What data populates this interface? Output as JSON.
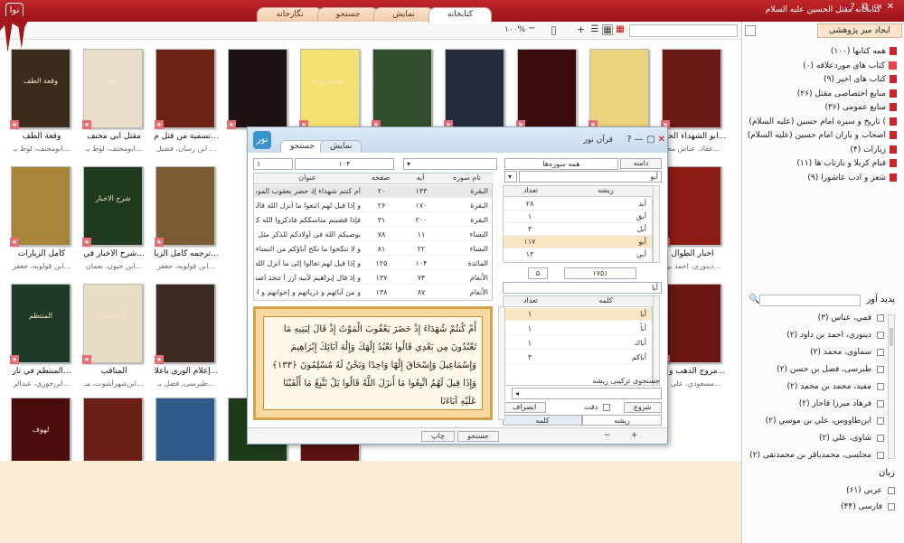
{
  "window": {
    "title": "کتابخانه مقتل الحسین علیه السلام",
    "logo_text": "نوا",
    "controls": [
      "?",
      "⧉",
      "▭",
      "✕"
    ]
  },
  "tabs": [
    "کتابخانه",
    "نمایش",
    "جستجو",
    "نگارخانه"
  ],
  "toolbar": {
    "zoom": "۱۰۰%",
    "minus": "−",
    "plus": "+"
  },
  "books": [
    {
      "title": "وقعة الطف",
      "author": "ابومخنف، لوط بـ...",
      "cover_color": "#3b2b1d",
      "cover_text": "وقعة الطف"
    },
    {
      "title": "مقتل أبي مخنف",
      "author": "ابومخنف، لوط بـ...",
      "cover_color": "#e9dcc9",
      "cover_text": "مقتل"
    },
    {
      "title": "تسمية من قتل م...",
      "author": "ابن رسان، فضيل ...",
      "cover_color": "#6d2316",
      "cover_text": ""
    },
    {
      "title": "",
      "author": "",
      "cover_color": "#1b1312",
      "cover_text": ""
    },
    {
      "title": "",
      "author": "",
      "cover_color": "#f3e070",
      "cover_text": "شهدای کربلا"
    },
    {
      "title": "",
      "author": "",
      "cover_color": "#2f4e2c",
      "cover_text": ""
    },
    {
      "title": "",
      "author": "",
      "cover_color": "#232a3c",
      "cover_text": ""
    },
    {
      "title": "",
      "author": "",
      "cover_color": "#3a0b0b",
      "cover_text": ""
    },
    {
      "title": "",
      "author": "",
      "cover_color": "#e9d37c",
      "cover_text": ""
    },
    {
      "title": "ابو الشهداء الحسـ...",
      "author": "عقاد، عباس محـ...",
      "cover_color": "#6a1a14",
      "cover_text": ""
    },
    {
      "title": "كامل الزيارات",
      "author": "ابن قولويه، جعفر...",
      "cover_color": "#a8843a",
      "cover_text": ""
    },
    {
      "title": "شرح الأخبار في...",
      "author": "ابن حيون، نعمان...",
      "cover_color": "#1f3a1e",
      "cover_text": "شرح الاخبار"
    },
    {
      "title": "ترجمه كامل الزيا...",
      "author": "ابن قولويه، جعفر...",
      "cover_color": "#7c5a34",
      "cover_text": ""
    },
    {
      "title": "أخبار الطوال",
      "author": "دينوري، احمد بن...",
      "cover_color": "#8b1b15",
      "cover_text": ""
    },
    {
      "title": "المنتظم في تار...",
      "author": "ابن‌جوزی، عبدالر...",
      "cover_color": "#1e3a29",
      "cover_text": "المنتظم"
    },
    {
      "title": "المناقب",
      "author": "ابن‌شهرآشوب، مـ...",
      "cover_color": "#e9dcc4",
      "cover_text": "المناقب"
    },
    {
      "title": "إعلام الورى بأعلا...",
      "author": "طبرسی، فضل بـ...",
      "cover_color": "#3d2b22",
      "cover_text": ""
    },
    {
      "title": "مروج الذهب و مـ...",
      "author": "مسعودي، علي بـ...",
      "cover_color": "#6a1612",
      "cover_text": ""
    },
    {
      "title": "",
      "author": "",
      "cover_color": "#4a0c0c",
      "cover_text": "لهوف"
    },
    {
      "title": "",
      "author": "",
      "cover_color": "#6b1e16",
      "cover_text": ""
    },
    {
      "title": "",
      "author": "",
      "cover_color": "#2f5a8a",
      "cover_text": ""
    },
    {
      "title": "",
      "author": "",
      "cover_color": "#1d3b1b",
      "cover_text": ""
    },
    {
      "title": "",
      "author": "",
      "cover_color": "#5a1212",
      "cover_text": ""
    }
  ],
  "sidebar": {
    "new_desk": "ایجاد میز پژوهشی",
    "categories": [
      {
        "label": "همه کتابها (۱۰۰)",
        "icon": "book-icon"
      },
      {
        "label": "کتاب های موردعلاقه (۰)",
        "icon": "star-icon"
      },
      {
        "label": "کتاب های اخیر (۹)",
        "icon": "book-icon"
      },
      {
        "label": "منابع اختصاصی مقتل (۲۶)",
        "icon": "book-icon"
      },
      {
        "label": "منابع عمومی (۳۶)",
        "icon": "book-icon"
      },
      {
        "label": "تاریخ و سیره امام حسین (علیه السلام) (",
        "icon": "book-icon"
      },
      {
        "label": "اصحاب و یاران امام حسین (علیه السلام)",
        "icon": "book-icon"
      },
      {
        "label": "زیارات (۴)",
        "icon": "book-icon"
      },
      {
        "label": "قیام کربلا و بازتاب ها (۱۱)",
        "icon": "book-icon"
      },
      {
        "label": "شعر و ادب عاشورا (۹)",
        "icon": "book-icon"
      }
    ],
    "authors_header": "پدید آور",
    "authors": [
      "قمي، عباس (۳)",
      "دينوري، احمد بن داود (۲)",
      "سماوی، محمد (۲)",
      "طبرسی، فضل بن حسن (۲)",
      "مفید، محمد بن محمد (۲)",
      "فرهاد میرزا قاجار (۲)",
      "ابن‌طاووس، علي بن موسي (۲)",
      "شاوی، علي (۲)",
      "مجلسی، محمدباقر بن محمدتقی (۲)"
    ],
    "language_header": "زبان",
    "languages": [
      "عربي (۶۱)",
      "فارسی (۴۴)"
    ]
  },
  "dialog": {
    "title": "قرآن نور",
    "icon_text": "نور",
    "tabs": [
      "جستجو",
      "نمایش"
    ],
    "range_left": "۱",
    "range_right": "۱۰۴",
    "scope_btn": "دامنه",
    "surah_select": "همه سوره‌ها",
    "root_input": "أبو",
    "results_columns": [
      "نام سوره",
      "آیه",
      "صفحه",
      "عنوان"
    ],
    "results": [
      {
        "surah": "البقرة",
        "ayah": "۱۳۳",
        "page": "۲۰",
        "text": "أم كنتم شهداء إذ حضر يعقوب الموت إذ ق..."
      },
      {
        "surah": "البقرة",
        "ayah": "۱۷۰",
        "page": "۲۶",
        "text": "و إذا قيل لهم اتبعوا ما أنزل الله قالوا بل نتبـ..."
      },
      {
        "surah": "البقرة",
        "ayah": "۲۰۰",
        "page": "۳۱",
        "text": "فإذا قضيتم مناسككم فاذكروا الله كذكركم آ..."
      },
      {
        "surah": "النساء",
        "ayah": "۱۱",
        "page": "۷۸",
        "text": "يوصيكم الله في أولادكم للذكر مثل حظ الأ..."
      },
      {
        "surah": "النساء",
        "ayah": "۲۲",
        "page": "۸۱",
        "text": "و لا تنكحوا ما نكح آباؤكم من النساء إلا ما ..."
      },
      {
        "surah": "المائدة",
        "ayah": "۱۰۴",
        "page": "۱۲۵",
        "text": "و إذا قيل لهم تعالوا إلى ما أنزل الله و إلى ال..."
      },
      {
        "surah": "الأنعام",
        "ayah": "۷۴",
        "page": "۱۳۷",
        "text": "و إذ قال إبراهيم لأبيه آزر أ تتخذ أصناما آل..."
      },
      {
        "surah": "الأنعام",
        "ayah": "۸۷",
        "page": "۱۳۸",
        "text": "و من آبائهم و ذرياتهم و إخوانهم و اجتبيناهـ..."
      }
    ],
    "roots_columns": [
      "ریشه",
      "تعداد"
    ],
    "roots": [
      {
        "root": "أبد",
        "count": "۲۸"
      },
      {
        "root": "أبق",
        "count": "۱"
      },
      {
        "root": "أبل",
        "count": "۳"
      },
      {
        "root": "أبو",
        "count": "۱۱۷"
      },
      {
        "root": "أبي",
        "count": "۱۳"
      }
    ],
    "roots_page": "۵",
    "roots_total": "۱۷۵۱",
    "word_input": "أبا",
    "words_columns": [
      "کلمه",
      "تعداد"
    ],
    "words": [
      {
        "word": "أبا",
        "count": "۱"
      },
      {
        "word": "أباً",
        "count": "۱"
      },
      {
        "word": "أباك",
        "count": "۱"
      },
      {
        "word": "أباكم",
        "count": "۳"
      }
    ],
    "compound_label": "جستجوی ترکیبی ریشه",
    "start_btn": "شروع",
    "precision_label": "دقت",
    "detach_btn": "انصراف",
    "subtabs": [
      "ریشه",
      "کلمه"
    ],
    "quran_text": "أَمْ كُنتُمْ شُهَدَاءَ إِذْ حَضَرَ يَعْقُوبَ الْمَوْتُ إِذْ قَالَ لِبَنِيهِ مَا تَعْبُدُونَ مِن بَعْدِي قَالُوا نَعْبُدُ إِلَٰهَكَ وَإِلَٰهَ آبَائِكَ إِبْرَاهِيمَ وَإِسْمَاعِيلَ وَإِسْحَاقَ إِلَٰهًا وَاحِدًا وَنَحْنُ لَهُ مُسْلِمُونَ ﴿١٣٣﴾ وَإِذَا قِيلَ لَهُمُ اتَّبِعُوا مَا أَنزَلَ اللَّهُ قَالُوا بَلْ نَتَّبِعُ مَا أَلْفَيْنَا عَلَيْهِ آبَاءَنَا",
    "footer_buttons": [
      "چاپ",
      "جستجو"
    ]
  },
  "colors": {
    "titlebar": "#b01c20",
    "accent": "#c7262a",
    "dialog_border": "#8fa6c0"
  }
}
